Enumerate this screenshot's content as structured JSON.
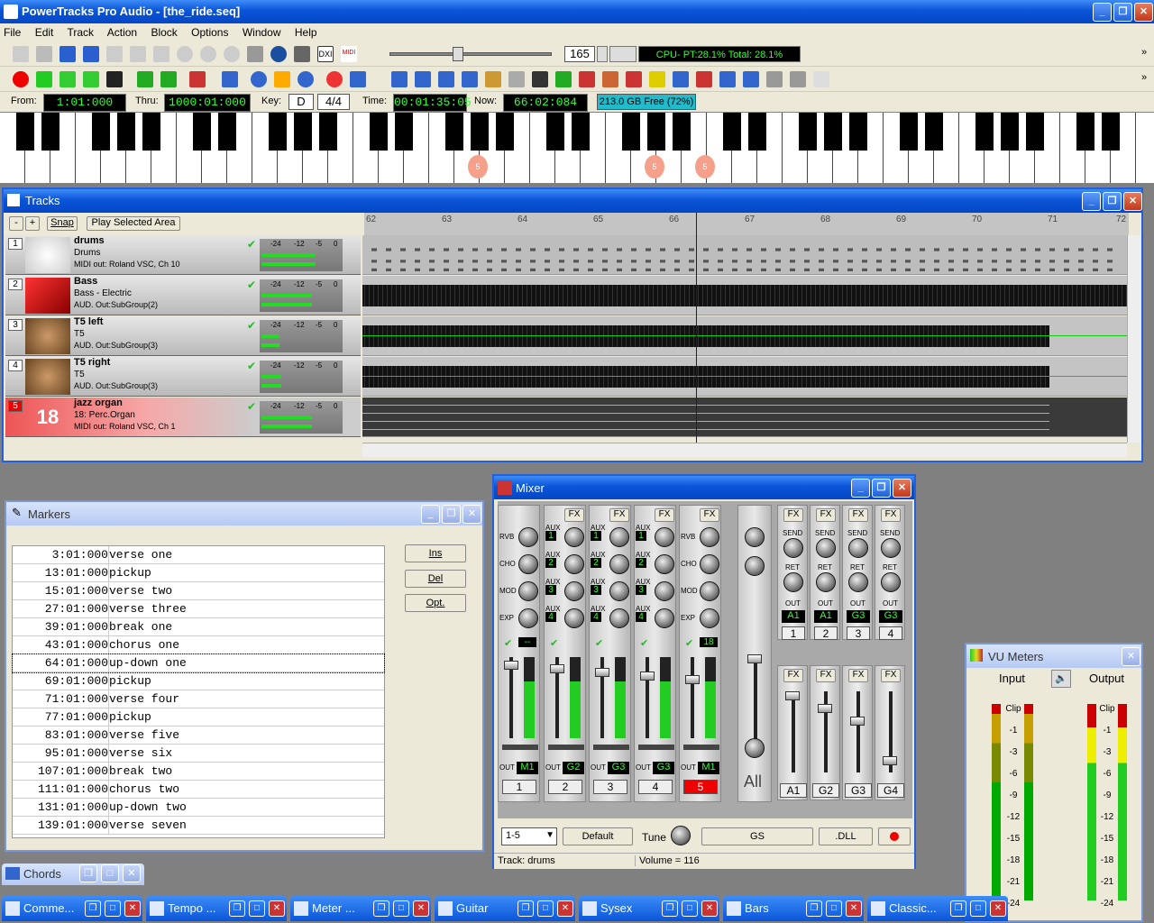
{
  "app": {
    "title": "PowerTracks Pro Audio - [the_ride.seq]"
  },
  "menu": [
    "File",
    "Edit",
    "Track",
    "Action",
    "Block",
    "Options",
    "Window",
    "Help"
  ],
  "toolbar": {
    "tempo": "165",
    "cpu": "CPU- PT:28.1% Total: 28.1%",
    "dll": "DXI",
    "midi": "MIDI"
  },
  "transport": {
    "from_label": "From:",
    "from": "1:01:000",
    "thru_label": "Thru:",
    "thru": "1000:01:000",
    "key_label": "Key:",
    "key": "D",
    "timesig": "4/4",
    "time_label": "Time:",
    "time": "00:01:35:05",
    "now_label": "Now:",
    "now": "66:02:084",
    "disk": "213.0 GB Free (72%)"
  },
  "piano": {
    "note_marks": [
      "5",
      "5",
      "5"
    ]
  },
  "tracks_window": {
    "title": "Tracks",
    "minus": "-",
    "plus": "+",
    "snap": "Snap",
    "play_selected": "Play Selected Area",
    "bars": [
      "62",
      "63",
      "64",
      "65",
      "66",
      "67",
      "68",
      "69",
      "70",
      "71",
      "72"
    ],
    "tracks": [
      {
        "num": "1",
        "name": "drums",
        "instrument": "Drums",
        "out": "MIDI out: Roland VSC, Ch 10",
        "db": [
          "-24",
          "-12",
          "-5",
          "0"
        ]
      },
      {
        "num": "2",
        "name": "Bass",
        "instrument": "Bass - Electric",
        "out": "AUD. Out:SubGroup(2)",
        "db": [
          "-24",
          "-12",
          "-5",
          "0"
        ]
      },
      {
        "num": "3",
        "name": "T5 left",
        "instrument": "T5",
        "out": "AUD. Out:SubGroup(3)",
        "db": [
          "-24",
          "-12",
          "-5",
          "0"
        ]
      },
      {
        "num": "4",
        "name": "T5 right",
        "instrument": "T5",
        "out": "AUD. Out:SubGroup(3)",
        "db": [
          "-24",
          "-12",
          "-5",
          "0"
        ]
      },
      {
        "num": "5",
        "name": "jazz organ",
        "instrument": "18: Perc.Organ",
        "out": "MIDI out: Roland VSC, Ch 1",
        "db": [
          "-24",
          "-12",
          "-5",
          "0"
        ],
        "icon_text": "18"
      }
    ]
  },
  "markers_window": {
    "title": "Markers",
    "ins": "Ins",
    "del": "Del",
    "opt": "Opt.",
    "rows": [
      {
        "time": "3:01:000",
        "name": "verse one"
      },
      {
        "time": "13:01:000",
        "name": "pickup"
      },
      {
        "time": "15:01:000",
        "name": "verse two"
      },
      {
        "time": "27:01:000",
        "name": "verse three"
      },
      {
        "time": "39:01:000",
        "name": "break one"
      },
      {
        "time": "43:01:000",
        "name": "chorus one"
      },
      {
        "time": "64:01:000",
        "name": "up-down one"
      },
      {
        "time": "69:01:000",
        "name": "pickup"
      },
      {
        "time": "71:01:000",
        "name": "verse four"
      },
      {
        "time": "77:01:000",
        "name": "pickup"
      },
      {
        "time": "83:01:000",
        "name": "verse five"
      },
      {
        "time": "95:01:000",
        "name": "verse six"
      },
      {
        "time": "107:01:000",
        "name": "break two"
      },
      {
        "time": "111:01:000",
        "name": "chorus two"
      },
      {
        "time": "131:01:000",
        "name": "up-down two"
      },
      {
        "time": "139:01:000",
        "name": "verse seven"
      }
    ]
  },
  "mixer": {
    "title": "Mixer",
    "fx": "FX",
    "aux": "AUX",
    "send": "SEND",
    "ret": "RET",
    "out": "OUT",
    "all": "All",
    "default_btn": "Default",
    "tune": "Tune",
    "gs": "GS",
    "dll": ".DLL",
    "range": "1-5",
    "status_track": "Track: drums",
    "status_volume": "Volume = 116",
    "row_labels": [
      "RVB",
      "CHO",
      "MOD",
      "EXP"
    ],
    "channels": [
      {
        "num": "1",
        "out": "M1",
        "lcd": "--"
      },
      {
        "num": "2",
        "out": "G2",
        "lcd": ""
      },
      {
        "num": "3",
        "out": "G3",
        "lcd": ""
      },
      {
        "num": "4",
        "out": "G3",
        "lcd": ""
      },
      {
        "num": "5",
        "out": "M1",
        "lcd": "18"
      }
    ],
    "aux_nums": [
      "1",
      "2",
      "3",
      "4"
    ],
    "groups_top": [
      {
        "out": "A1",
        "num": "1"
      },
      {
        "out": "A1",
        "num": "2"
      },
      {
        "out": "G3",
        "num": "3"
      },
      {
        "out": "G3",
        "num": "4"
      }
    ],
    "groups_bottom": [
      "A1",
      "G2",
      "G3",
      "G4"
    ]
  },
  "vu": {
    "title": "VU Meters",
    "input": "Input",
    "output": "Output",
    "scale": [
      "Clip",
      "-1",
      "-3",
      "-6",
      "-9",
      "-12",
      "-15",
      "-18",
      "-21",
      "-24"
    ]
  },
  "chords": {
    "title": "Chords"
  },
  "taskbar": [
    "Comme...",
    "Tempo ...",
    "Meter ...",
    "Guitar",
    "Sysex",
    "Bars",
    "Classic..."
  ]
}
